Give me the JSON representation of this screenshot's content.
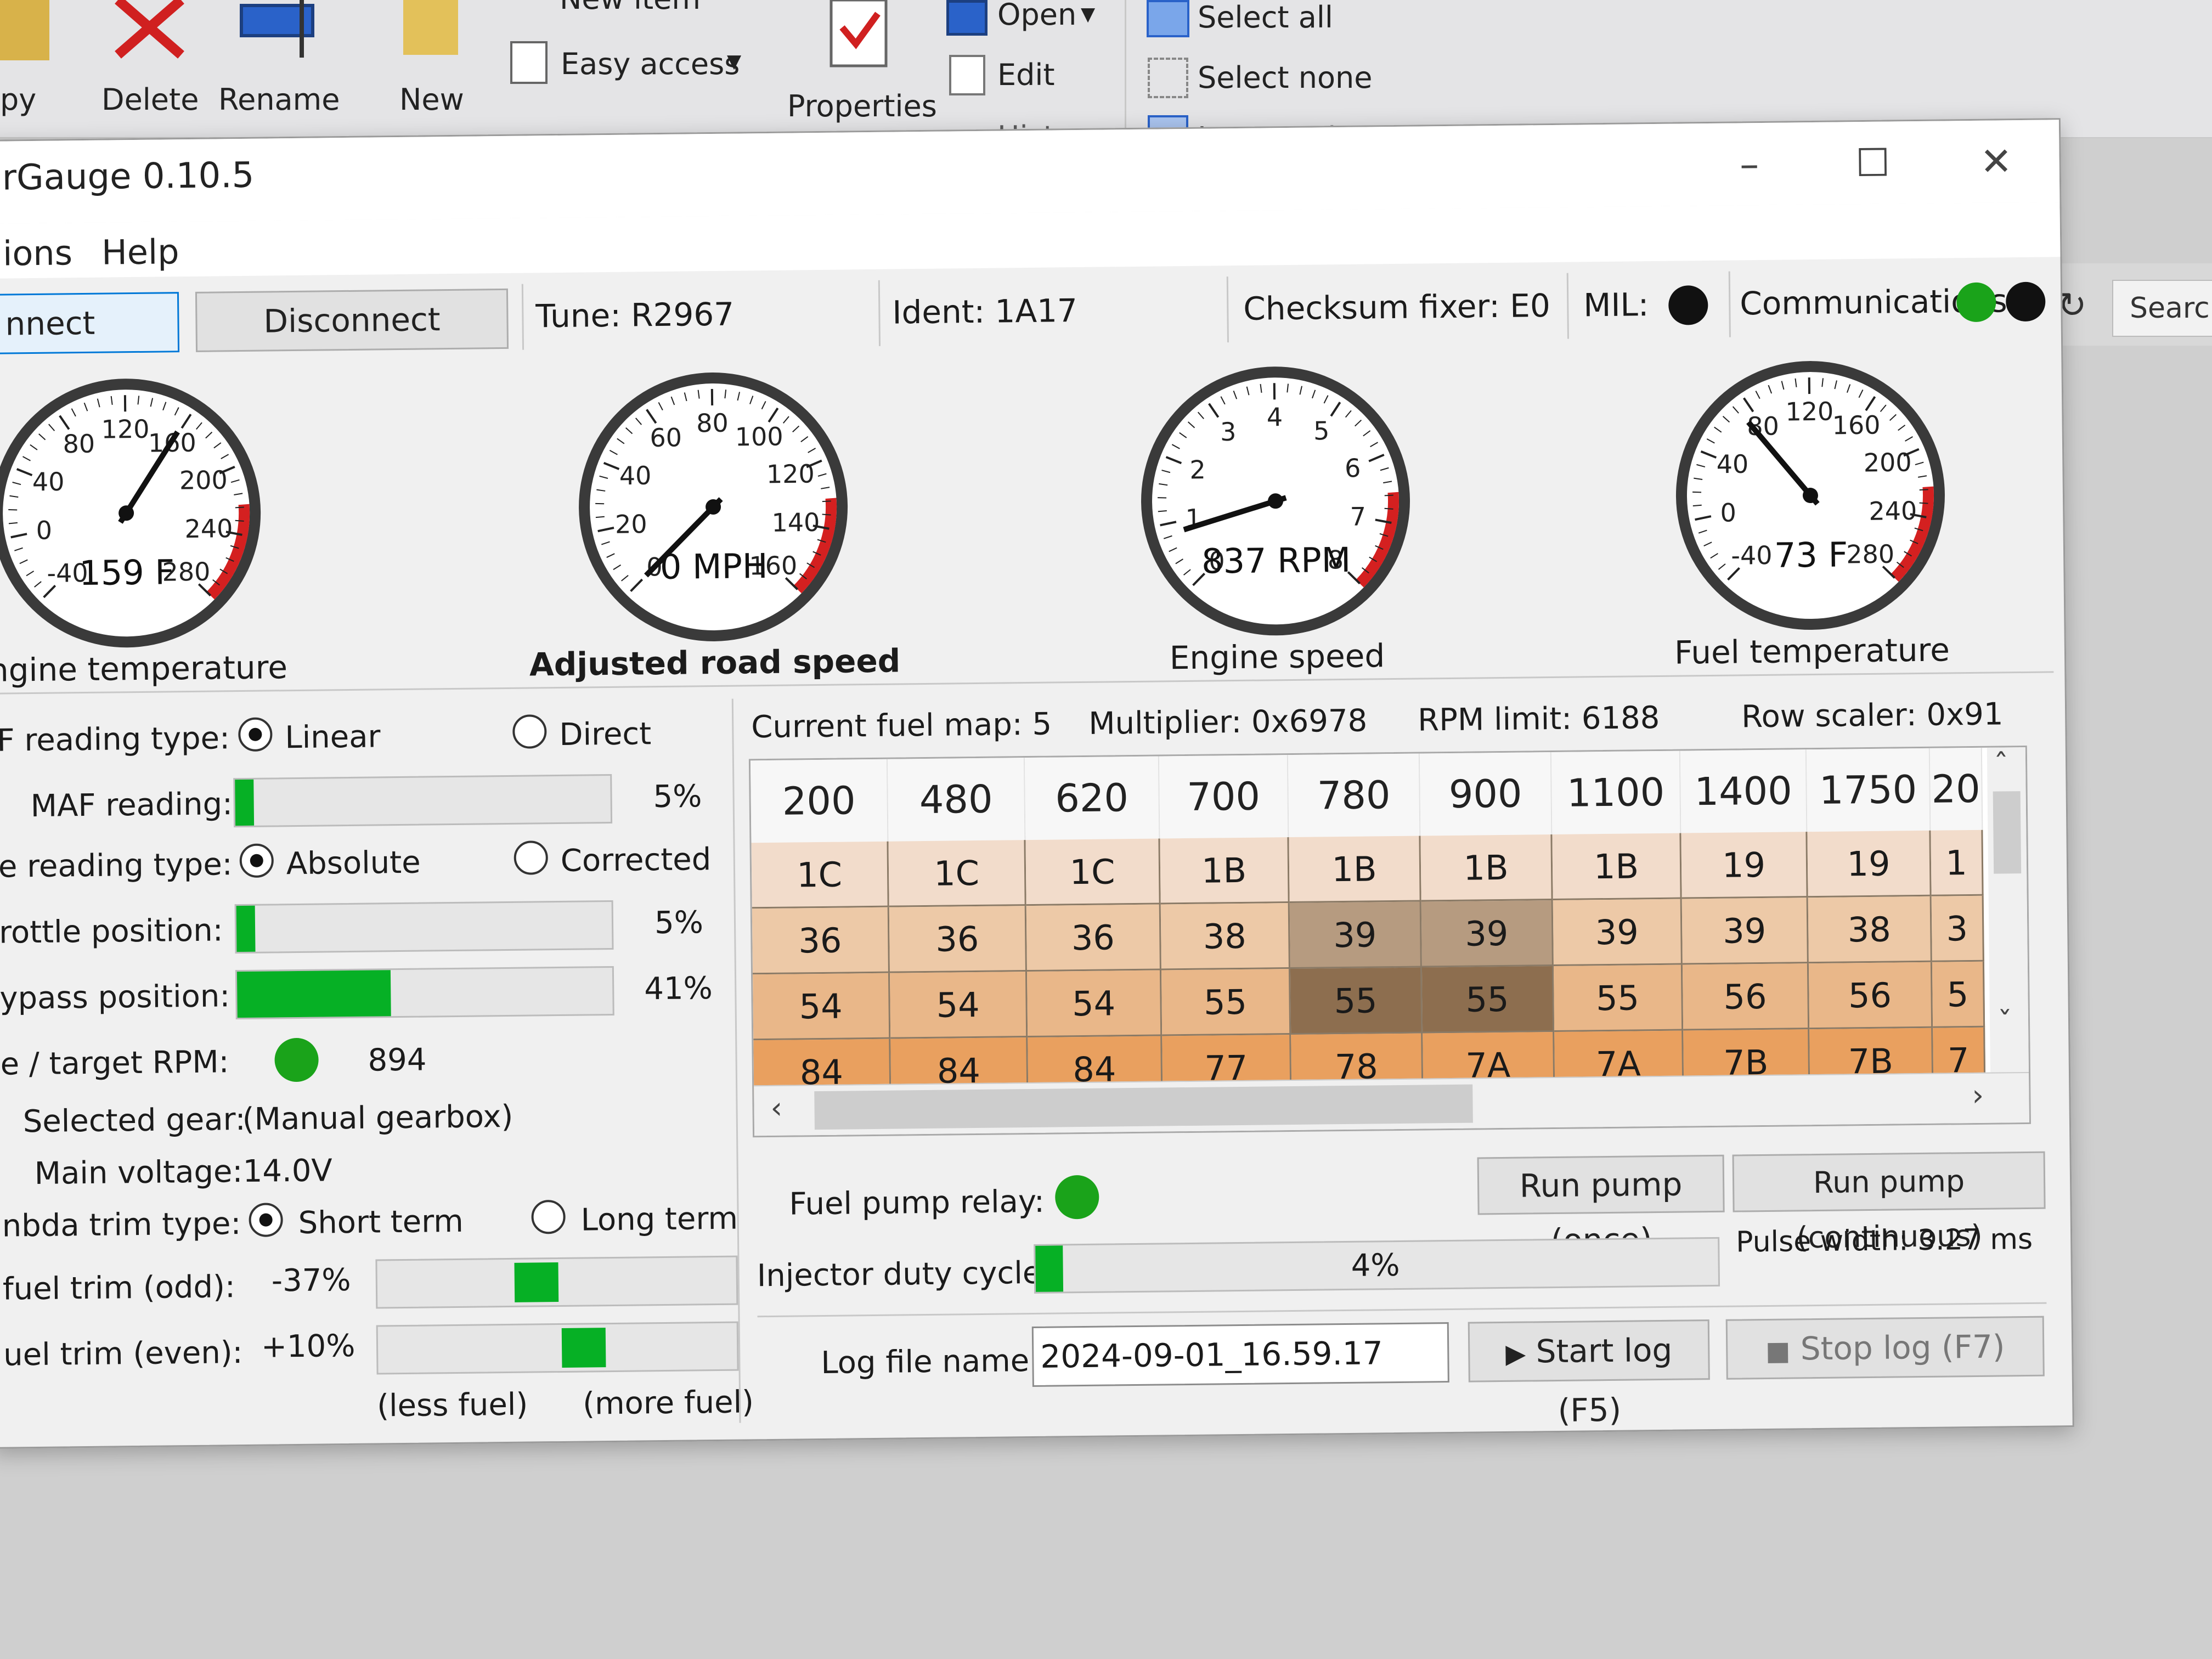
{
  "explorer": {
    "copy_label": "py",
    "delete_label": "Delete",
    "rename_label": "Rename",
    "new_label": "New",
    "new_item_label": "New item",
    "easy_access_label": "Easy access",
    "properties_label": "Properties",
    "open_label": "Open",
    "edit_label": "Edit",
    "history_label": "History",
    "select_all_label": "Select all",
    "select_none_label": "Select none",
    "invert_selection_label": "Invert selection",
    "search_label": "Search"
  },
  "window": {
    "title": "rGauge 0.10.5",
    "menu": [
      "ions",
      "Help"
    ]
  },
  "toolbar": {
    "connect_label": "nnect",
    "disconnect_label": "Disconnect",
    "tune": "Tune: R2967",
    "ident": "Ident: 1A17",
    "checksum": "Checksum fixer: E0",
    "mil_label": "MIL:",
    "comms_label": "Communications:",
    "colors": {
      "mil": "#111111",
      "comms_ok": "#1aa31a",
      "comms_idle": "#111111"
    }
  },
  "gauges": [
    {
      "id": "engine-temp",
      "caption": "Engine temperature",
      "readout": "159 F",
      "ticks": [
        "-40",
        "0",
        "40",
        "80",
        "120",
        "160",
        "200",
        "240",
        "280"
      ],
      "value": 159,
      "min": -40,
      "max": 280
    },
    {
      "id": "road-speed",
      "caption": "Adjusted road speed",
      "readout": "0 MPH",
      "ticks": [
        "0",
        "20",
        "40",
        "60",
        "80",
        "100",
        "120",
        "140",
        "160"
      ],
      "value": 0,
      "min": 0,
      "max": 160
    },
    {
      "id": "engine-speed",
      "caption": "Engine speed",
      "readout": "837 RPM",
      "ticks": [
        "0",
        "1",
        "2",
        "3",
        "4",
        "5",
        "6",
        "7",
        "8"
      ],
      "value": 0.837,
      "min": 0,
      "max": 8
    },
    {
      "id": "fuel-temp",
      "caption": "Fuel temperature",
      "readout": "73 F",
      "ticks": [
        "-40",
        "0",
        "40",
        "80",
        "120",
        "160",
        "200",
        "240",
        "280"
      ],
      "value": 73,
      "min": -40,
      "max": 280
    }
  ],
  "left": {
    "maf_type_label": "F reading type:",
    "linear_label": "Linear",
    "direct_label": "Direct",
    "maf_label": "MAF reading:",
    "maf_value": "5%",
    "maf_fraction": 0.05,
    "temp_type_label": "e reading type:",
    "absolute_label": "Absolute",
    "corrected_label": "Corrected",
    "throttle_label": "rottle position:",
    "throttle_value": "5%",
    "throttle_fraction": 0.05,
    "bypass_label": "ypass position:",
    "bypass_value": "41%",
    "bypass_fraction": 0.41,
    "target_rpm_label": "e / target RPM:",
    "target_rpm_value": "894",
    "gear_label": "Selected gear:",
    "gear_value": "(Manual gearbox)",
    "voltage_label": "Main voltage:",
    "voltage_value": "14.0V",
    "lambda_type_label": "nbda trim type:",
    "short_term_label": "Short term",
    "long_term_label": "Long term",
    "trim_odd_label": "fuel trim (odd):",
    "trim_odd_value": "-37%",
    "trim_even_label": "uel trim (even):",
    "trim_even_value": "+10%",
    "less_fuel": "(less fuel)",
    "more_fuel": "(more fuel)"
  },
  "fuelmap": {
    "current_map": "Current fuel map: 5",
    "multiplier": "Multiplier: 0x6978",
    "rpm_limit": "RPM limit: 6188",
    "row_scaler": "Row scaler: 0x91",
    "columns": [
      "200",
      "480",
      "620",
      "700",
      "780",
      "900",
      "1100",
      "1400",
      "1750",
      "20"
    ],
    "rows": [
      [
        "1C",
        "1C",
        "1C",
        "1B",
        "1B",
        "1B",
        "1B",
        "19",
        "19",
        "1"
      ],
      [
        "36",
        "36",
        "36",
        "38",
        "39",
        "39",
        "39",
        "39",
        "38",
        "3"
      ],
      [
        "54",
        "54",
        "54",
        "55",
        "55",
        "55",
        "55",
        "56",
        "56",
        "5"
      ],
      [
        "84",
        "84",
        "84",
        "77",
        "78",
        "7A",
        "7A",
        "7B",
        "7B",
        "7"
      ]
    ],
    "row_colors": [
      "#f2dccb",
      "#edc9a7",
      "#e9b789",
      "#e9a05f"
    ],
    "highlight_color": "#9a7a5a"
  },
  "bottom": {
    "pump_relay_label": "Fuel pump relay:",
    "run_once_label": "Run pump (once)",
    "run_cont_label": "Run pump (continuous)",
    "injector_label": "Injector duty cycle:",
    "injector_value": "4%",
    "injector_fraction": 0.04,
    "pulse_width": "Pulse width: 3.27 ms",
    "log_label": "Log file name:",
    "log_value": "2024-09-01_16.59.17",
    "start_log_label": "Start log (F5)",
    "stop_log_label": "Stop log (F7)"
  }
}
